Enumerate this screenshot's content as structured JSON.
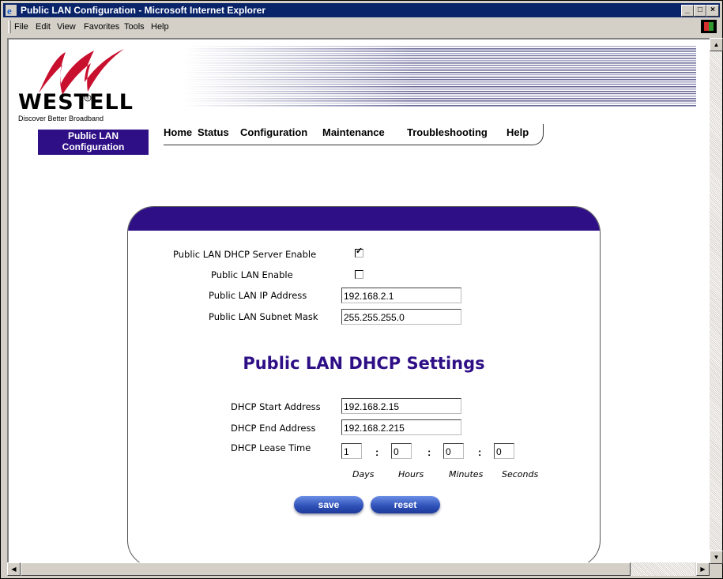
{
  "window": {
    "title": "Public LAN Configuration - Microsoft Internet Explorer",
    "controls": [
      "_",
      "□",
      "×"
    ]
  },
  "menu": [
    "File",
    "Edit",
    "View",
    "Favorites",
    "Tools",
    "Help"
  ],
  "brand": {
    "name": "WESTELL",
    "registered": "®",
    "tagline": "Discover Better Broadband"
  },
  "nav": [
    "Home",
    "Status",
    "Configuration",
    "Maintenance",
    "Troubleshooting",
    "Help"
  ],
  "section_tab": {
    "line1": "Public LAN",
    "line2": "Configuration"
  },
  "form": {
    "dhcp_server_enable": {
      "label": "Public LAN DHCP Server Enable",
      "checked": true
    },
    "lan_enable": {
      "label": "Public LAN Enable",
      "checked": false
    },
    "ip_address": {
      "label": "Public LAN IP Address",
      "value": "192.168.2.1"
    },
    "subnet_mask": {
      "label": "Public LAN Subnet Mask",
      "value": "255.255.255.0"
    }
  },
  "dhcp": {
    "title": "Public LAN DHCP Settings",
    "start": {
      "label": "DHCP Start Address",
      "value": "192.168.2.15"
    },
    "end": {
      "label": "DHCP End Address",
      "value": "192.168.2.215"
    },
    "lease": {
      "label": "DHCP Lease Time",
      "days": "1",
      "hours": "0",
      "minutes": "0",
      "seconds": "0",
      "separator": ":",
      "units": {
        "days": "Days",
        "hours": "Hours",
        "minutes": "Minutes",
        "seconds": "Seconds"
      }
    }
  },
  "buttons": {
    "save": "save",
    "reset": "reset"
  },
  "colors": {
    "brand_purple": "#2e0f86",
    "titlebar": "#0a246a",
    "logo_red": "#c8102e",
    "button_blue": "#2d4fb6"
  }
}
